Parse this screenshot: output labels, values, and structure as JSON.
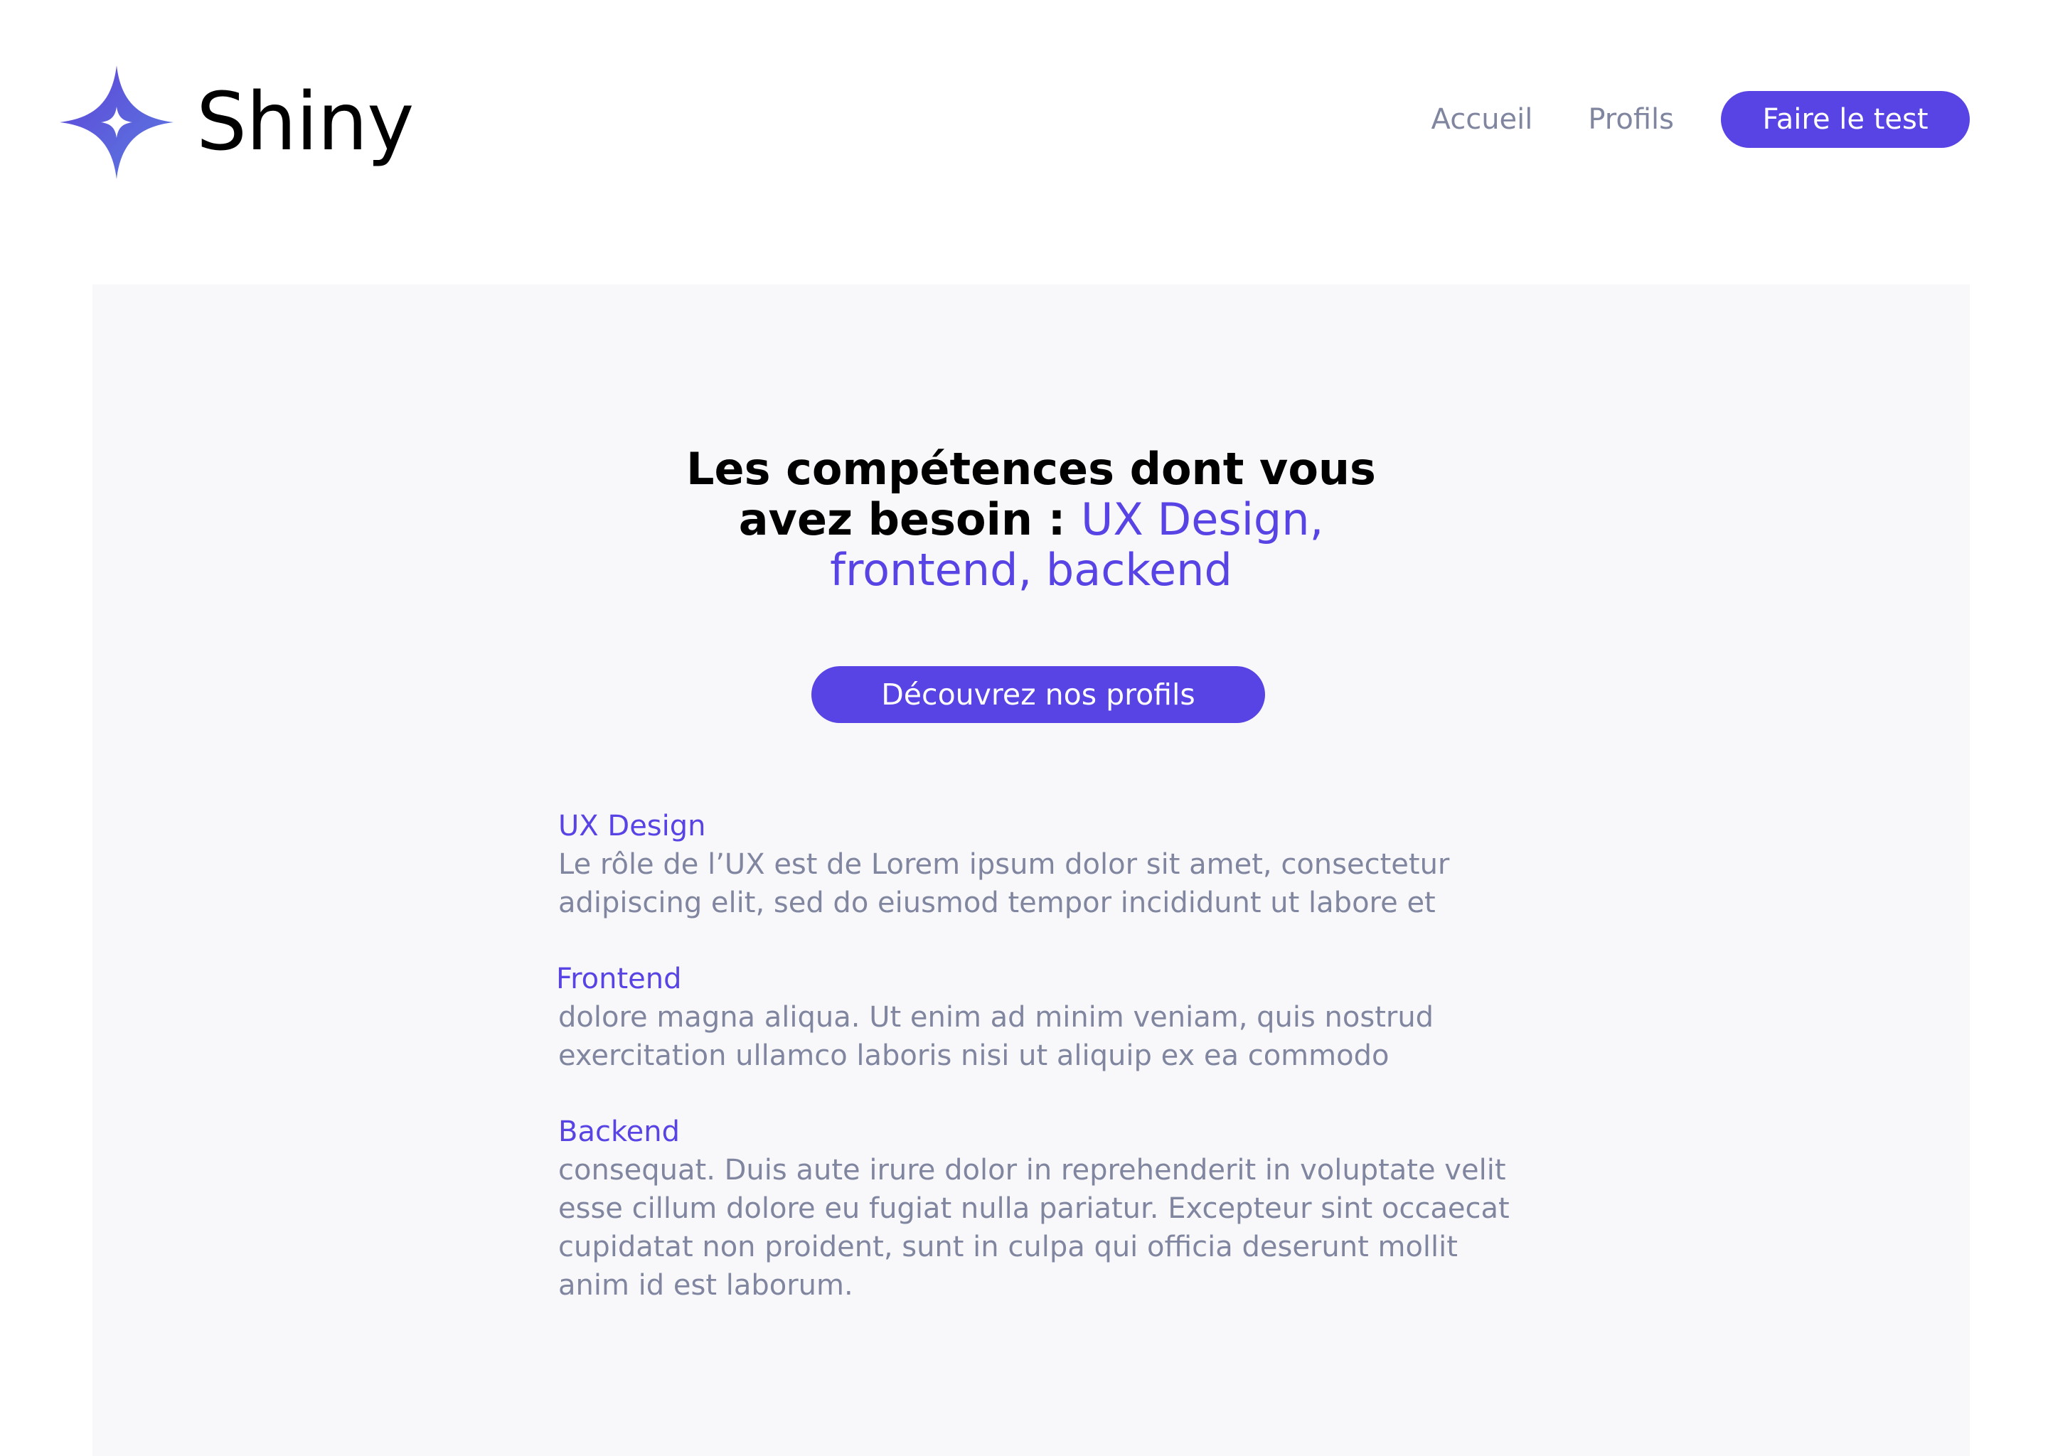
{
  "header": {
    "logo_text": "Shiny",
    "logo_icon": "sparkle-star-icon",
    "nav": {
      "home_label": "Accueil",
      "profiles_label": "Profils",
      "cta_label": "Faire le test"
    }
  },
  "hero": {
    "title_line1": "Les compétences dont vous",
    "title_line2_prefix": "avez besoin : ",
    "title_line2_accent": "UX Design,",
    "title_line3_accent": "frontend, backend",
    "cta_label": "Découvrez nos profils"
  },
  "skills": [
    {
      "title": "UX Design",
      "description": "Le rôle de l’UX est de Lorem ipsum dolor sit amet, consectetur\nadipiscing elit, sed do eiusmod tempor incididunt ut labore et"
    },
    {
      "title": "Frontend",
      "description": "dolore magna aliqua. Ut enim ad minim veniam, quis nostrud\nexercitation ullamco laboris nisi ut aliquip ex ea commodo"
    },
    {
      "title": "Backend",
      "description": " consequat. Duis aute irure dolor in reprehenderit in voluptate velit\nesse cillum dolore eu fugiat nulla pariatur. Excepteur sint occaecat\ncupidatat non proident, sunt in culpa qui officia deserunt mollit\nanim id est laborum."
    }
  ],
  "colors": {
    "accent": "#5843e4",
    "muted_text": "#8186a0",
    "panel_background": "#f8f8fa",
    "logo_gradient_start": "#5f45d8",
    "logo_gradient_end": "#5a7be0"
  }
}
